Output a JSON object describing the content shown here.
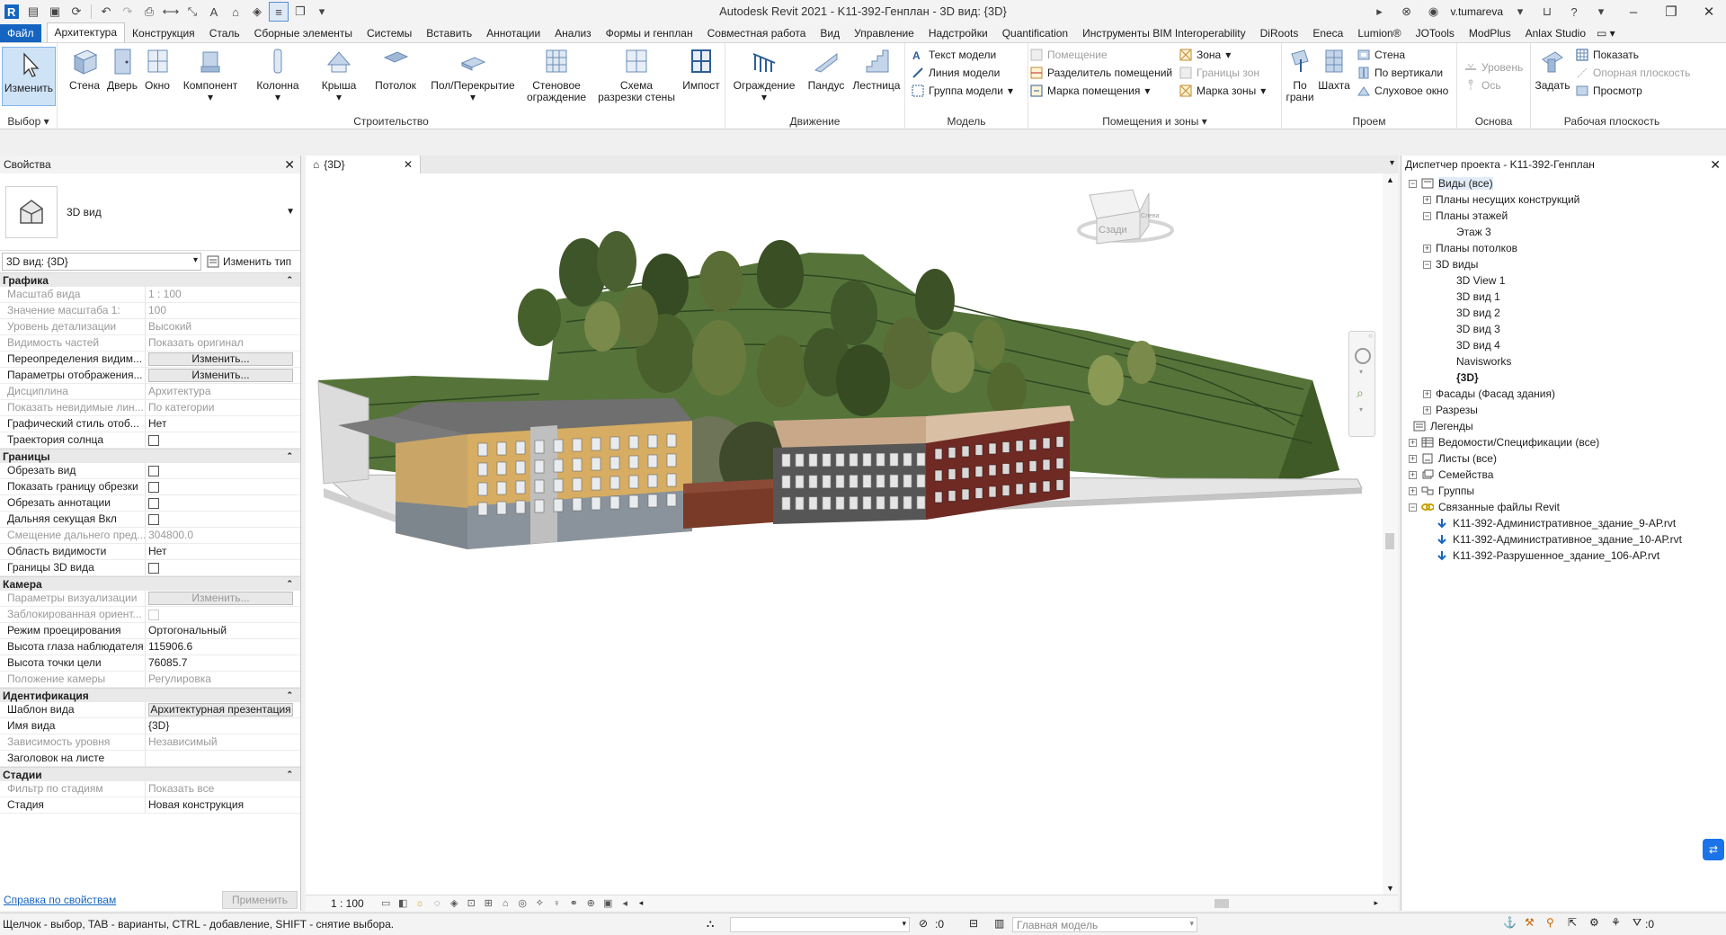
{
  "window": {
    "title": "Autodesk Revit 2021 - K11-392-Генплан - 3D вид: {3D}",
    "user": "v.tumareva"
  },
  "menu": {
    "tabs": [
      "Файл",
      "Архитектура",
      "Конструкция",
      "Сталь",
      "Сборные элементы",
      "Системы",
      "Вставить",
      "Аннотации",
      "Анализ",
      "Формы и генплан",
      "Совместная работа",
      "Вид",
      "Управление",
      "Надстройки",
      "Quantification",
      "Инструменты BIM Interoperability",
      "DiRoots",
      "Eneca",
      "Lumion®",
      "JOTools",
      "ModPlus",
      "Anlax Studio"
    ],
    "active": "Архитектура"
  },
  "ribbon": {
    "select": {
      "btn": "Изменить",
      "title": "Выбор"
    },
    "build": {
      "title": "Строительство",
      "buttons": [
        "Стена",
        "Дверь",
        "Окно",
        "Компонент",
        "Колонна",
        "Крыша",
        "Потолок",
        "Пол/Перекрытие",
        "Стеновое ограждение",
        "Схема разрезки стены",
        "Импост"
      ]
    },
    "circ": {
      "title": "Движение",
      "buttons": [
        "Ограждение",
        "Пандус",
        "Лестница"
      ]
    },
    "model": {
      "title": "Модель",
      "items": [
        "Текст модели",
        "Линия модели",
        "Группа модели"
      ]
    },
    "rooms": {
      "title": "Помещения и зоны",
      "items": [
        "Помещение",
        "Разделитель помещений",
        "Марка помещения",
        "Зона",
        "Границы зон",
        "Марка зоны"
      ]
    },
    "opening": {
      "title": "Проем",
      "big": [
        "По грани",
        "Шахта"
      ],
      "items": [
        "Стена",
        "По вертикали",
        "Слуховое окно"
      ]
    },
    "datum": {
      "title": "Основа",
      "items": [
        "Уровень",
        "Ось"
      ]
    },
    "workplane": {
      "title": "Рабочая плоскость",
      "big": "Задать",
      "items": [
        "Показать",
        "Опорная плоскость",
        "Просмотр"
      ]
    }
  },
  "properties": {
    "title": "Свойства",
    "type": "3D вид",
    "view_selector": "3D вид: {3D}",
    "edit_type": "Изменить тип",
    "sections": [
      {
        "name": "Графика",
        "rows": [
          {
            "n": "Масштаб вида",
            "v": "1 : 100",
            "g": true
          },
          {
            "n": "Значение масштаба   1:",
            "v": "100",
            "g": true
          },
          {
            "n": "Уровень детализации",
            "v": "Высокий",
            "g": true
          },
          {
            "n": "Видимость частей",
            "v": "Показать оригинал",
            "g": true
          },
          {
            "n": "Переопределения видим...",
            "v": "Изменить...",
            "btn": true
          },
          {
            "n": "Параметры отображения...",
            "v": "Изменить...",
            "btn": true
          },
          {
            "n": "Дисциплина",
            "v": "Архитектура",
            "g": true
          },
          {
            "n": "Показать невидимые лин...",
            "v": "По категории",
            "g": true
          },
          {
            "n": "Графический стиль отоб...",
            "v": "Нет"
          },
          {
            "n": "Траектория солнца",
            "v": "",
            "chk": true
          }
        ]
      },
      {
        "name": "Границы",
        "rows": [
          {
            "n": "Обрезать вид",
            "v": "",
            "chk": true
          },
          {
            "n": "Показать границу обрезки",
            "v": "",
            "chk": true
          },
          {
            "n": "Обрезать аннотации",
            "v": "",
            "chk": true
          },
          {
            "n": "Дальняя секущая Вкл",
            "v": "",
            "chk": true
          },
          {
            "n": "Смещение дальнего пред...",
            "v": "304800.0",
            "g": true
          },
          {
            "n": "Область видимости",
            "v": "Нет"
          },
          {
            "n": "Границы 3D вида",
            "v": "",
            "chk": true
          }
        ]
      },
      {
        "name": "Камера",
        "rows": [
          {
            "n": "Параметры визуализации",
            "v": "Изменить...",
            "btn": true,
            "g": true
          },
          {
            "n": "Заблокированная ориент...",
            "v": "",
            "chk": true,
            "g": true
          },
          {
            "n": "Режим проецирования",
            "v": "Ортогональный"
          },
          {
            "n": "Высота глаза наблюдателя",
            "v": "115906.6"
          },
          {
            "n": "Высота точки цели",
            "v": "76085.7"
          },
          {
            "n": "Положение камеры",
            "v": "Регулировка",
            "g": true
          }
        ]
      },
      {
        "name": "Идентификация",
        "rows": [
          {
            "n": "Шаблон вида",
            "v": "Архитектурная презентация",
            "btn": true
          },
          {
            "n": "Имя вида",
            "v": "{3D}"
          },
          {
            "n": "Зависимость уровня",
            "v": "Независимый",
            "g": true
          },
          {
            "n": "Заголовок на листе",
            "v": ""
          }
        ]
      },
      {
        "name": "Стадии",
        "rows": [
          {
            "n": "Фильтр по стадиям",
            "v": "Показать все",
            "g": true
          },
          {
            "n": "Стадия",
            "v": "Новая конструкция"
          }
        ]
      }
    ],
    "help": "Справка по свойствам",
    "apply": "Применить"
  },
  "view": {
    "tab": "{3D}",
    "scale": "1 : 100",
    "cube_face1": "Сзади",
    "cube_face2": "Слева"
  },
  "browser": {
    "title": "Диспетчер проекта - K11-392-Генплан",
    "tree": [
      {
        "t": "Виды (все)",
        "lvl": 0,
        "exp": "-",
        "ic": "views"
      },
      {
        "t": "Планы несущих конструкций",
        "lvl": 1,
        "exp": "+"
      },
      {
        "t": "Планы этажей",
        "lvl": 1,
        "exp": "-"
      },
      {
        "t": "Этаж 3",
        "lvl": 2
      },
      {
        "t": "Планы потолков",
        "lvl": 1,
        "exp": "+"
      },
      {
        "t": "3D виды",
        "lvl": 1,
        "exp": "-"
      },
      {
        "t": "3D View 1",
        "lvl": 2
      },
      {
        "t": "3D вид 1",
        "lvl": 2
      },
      {
        "t": "3D вид 2",
        "lvl": 2
      },
      {
        "t": "3D вид 3",
        "lvl": 2
      },
      {
        "t": "3D вид 4",
        "lvl": 2
      },
      {
        "t": "Navisworks",
        "lvl": 2
      },
      {
        "t": "{3D}",
        "lvl": 2,
        "bold": true
      },
      {
        "t": "Фасады (Фасад здания)",
        "lvl": 1,
        "exp": "+"
      },
      {
        "t": "Разрезы",
        "lvl": 1,
        "exp": "+"
      },
      {
        "t": "Легенды",
        "lvl": 0,
        "ic": "legend"
      },
      {
        "t": "Ведомости/Спецификации (все)",
        "lvl": 0,
        "exp": "+",
        "ic": "table"
      },
      {
        "t": "Листы (все)",
        "lvl": 0,
        "exp": "+",
        "ic": "sheet"
      },
      {
        "t": "Семейства",
        "lvl": 0,
        "exp": "+",
        "ic": "family"
      },
      {
        "t": "Группы",
        "lvl": 0,
        "exp": "+",
        "ic": "group"
      },
      {
        "t": "Связанные файлы Revit",
        "lvl": 0,
        "exp": "-",
        "ic": "link"
      },
      {
        "t": "K11-392-Административное_здание_9-АР.rvt",
        "lvl": 1,
        "ic": "arrow"
      },
      {
        "t": "K11-392-Административное_здание_10-АР.rvt",
        "lvl": 1,
        "ic": "arrow"
      },
      {
        "t": "K11-392-Разрушенное_здание_106-АР.rvt",
        "lvl": 1,
        "ic": "arrow"
      }
    ]
  },
  "status": {
    "hint": "Щелчок - выбор, TAB - варианты, CTRL - добавление, SHIFT - снятие выбора.",
    "sel_count": ":0",
    "model": "Главная модель",
    "filter_count": ":0"
  },
  "colors": {
    "file_tab": "#1565c0",
    "accent": "#1565c0",
    "terrain": "#56743a"
  }
}
